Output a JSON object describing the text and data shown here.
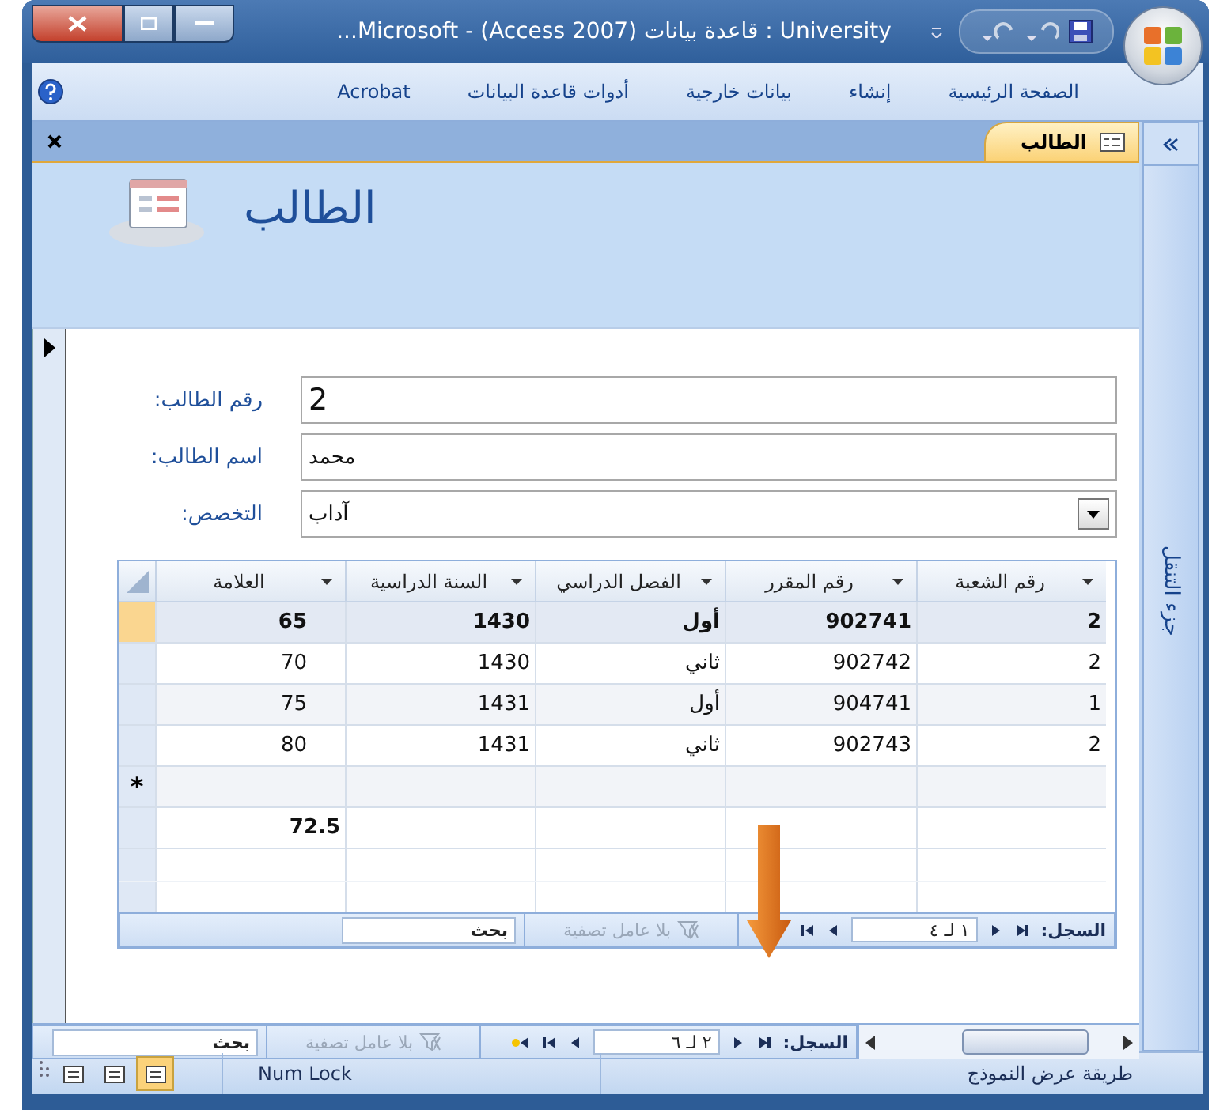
{
  "window": {
    "title": "University : قاعدة بيانات (Access 2007) - Microsoft..."
  },
  "ribbon_tabs": [
    {
      "label": "الصفحة الرئيسية"
    },
    {
      "label": "إنشاء"
    },
    {
      "label": "بيانات خارجية"
    },
    {
      "label": "أدوات قاعدة البيانات"
    },
    {
      "label": "Acrobat"
    }
  ],
  "document_tab": {
    "label": "الطالب"
  },
  "navigation_pane": {
    "label": "جزء التنقل"
  },
  "form": {
    "title": "الطالب",
    "fields": [
      {
        "kind": "text",
        "label": "رقم الطالب:",
        "value": "2",
        "large": true
      },
      {
        "kind": "text",
        "label": "اسم الطالب:",
        "value": "محمد",
        "large": false
      },
      {
        "kind": "combo",
        "label": "التخصص:",
        "value": "آداب",
        "large": false
      }
    ]
  },
  "subform": {
    "columns": [
      "رقم الشعبة",
      "رقم المقرر",
      "الفصل الدراسي",
      "السنة الدراسية",
      "العلامة"
    ],
    "rows": [
      {
        "current": true,
        "cells": [
          "2",
          "902741",
          "أول",
          "1430",
          "65"
        ]
      },
      {
        "current": false,
        "cells": [
          "2",
          "902742",
          "ثاني",
          "1430",
          "70"
        ]
      },
      {
        "current": false,
        "cells": [
          "1",
          "904741",
          "أول",
          "1431",
          "75"
        ]
      },
      {
        "current": false,
        "cells": [
          "2",
          "902743",
          "ثاني",
          "1431",
          "80"
        ]
      }
    ],
    "new_row_marker": "*",
    "total": "72.5",
    "navigation": {
      "label": "السجل:",
      "position": "١ لـ ٤",
      "filter": "بلا عامل تصفية",
      "search": "بحث"
    }
  },
  "record_navigation": {
    "label": "السجل:",
    "position": "٢ لـ ٦",
    "filter": "بلا عامل تصفية",
    "search": "بحث"
  },
  "status_bar": {
    "view": "طريقة عرض النموذج",
    "num_lock": "Num Lock"
  }
}
